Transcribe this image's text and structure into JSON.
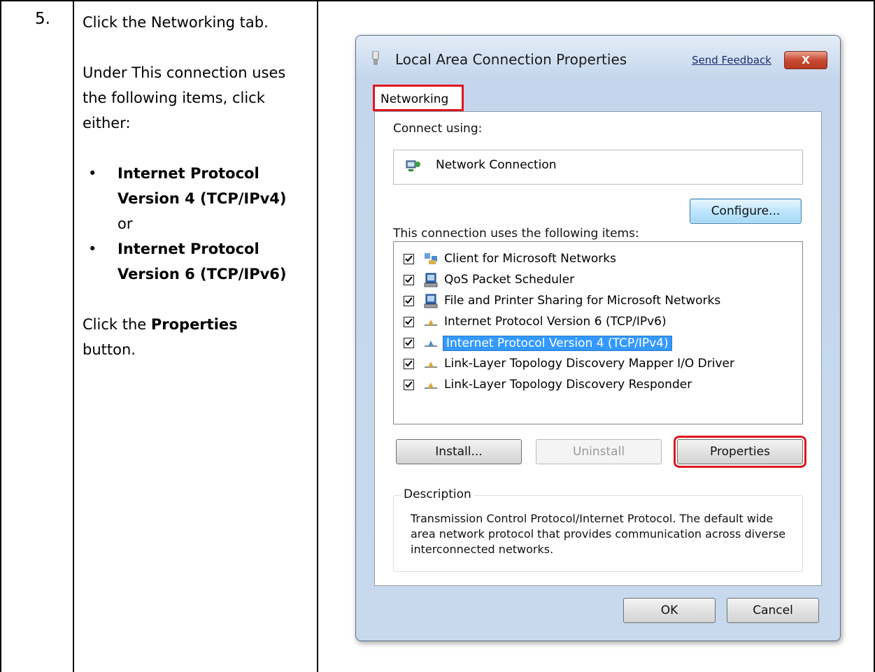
{
  "step": {
    "number": "5."
  },
  "instructions": {
    "line1": "Click the Networking tab.",
    "line2": "Under This connection uses the following items, click either:",
    "bullet1": "Internet Protocol Version 4 (TCP/IPv4)",
    "or": "or",
    "bullet2": "Internet Protocol Version 6 (TCP/IPv6)",
    "line3_prefix": "Click the ",
    "line3_bold": "Properties",
    "line3_suffix": " button."
  },
  "dialog": {
    "title": "Local Area Connection Properties",
    "send_feedback": "Send Feedback",
    "close_label": "X",
    "tab": "Networking",
    "connect_using_label": "Connect using:",
    "adapter": "Network Connection",
    "configure_button": "Configure...",
    "items_label": "This connection uses the following items:",
    "items": [
      {
        "label": "Client for Microsoft Networks",
        "checked": true,
        "icon": "network-client-icon"
      },
      {
        "label": "QoS Packet Scheduler",
        "checked": true,
        "icon": "service-computer-icon"
      },
      {
        "label": "File and Printer Sharing for Microsoft Networks",
        "checked": true,
        "icon": "service-computer-icon"
      },
      {
        "label": "Internet Protocol Version 6 (TCP/IPv6)",
        "checked": true,
        "icon": "protocol-icon"
      },
      {
        "label": "Internet Protocol Version 4 (TCP/IPv4)",
        "checked": true,
        "icon": "protocol-icon",
        "selected": true
      },
      {
        "label": "Link-Layer Topology Discovery Mapper I/O Driver",
        "checked": true,
        "icon": "protocol-icon"
      },
      {
        "label": "Link-Layer Topology Discovery Responder",
        "checked": true,
        "icon": "protocol-icon"
      }
    ],
    "install_button": "Install...",
    "uninstall_button": "Uninstall",
    "properties_button": "Properties",
    "description_title": "Description",
    "description_text": "Transmission Control Protocol/Internet Protocol. The default wide area network protocol that provides communication across diverse interconnected networks.",
    "ok_button": "OK",
    "cancel_button": "Cancel",
    "highlight_color": "#e0161e",
    "selection_color": "#3399ff"
  }
}
